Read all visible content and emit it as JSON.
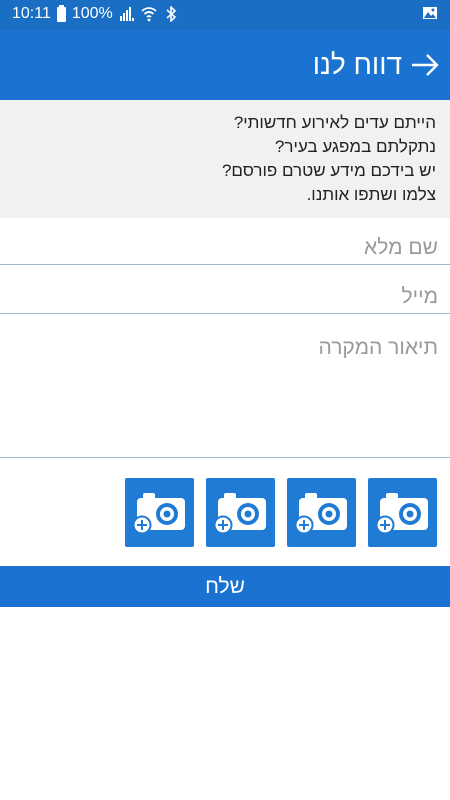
{
  "status_bar": {
    "time": "10:11",
    "battery": "100%"
  },
  "app_bar": {
    "title": "דווח לנו"
  },
  "intro": {
    "lines": [
      "הייתם עדים לאירוע חדשותי?",
      "נתקלתם במפגע בעיר?",
      "יש בידכם מידע שטרם פורסם?",
      "צלמו ושתפו אותנו."
    ]
  },
  "form": {
    "full_name_placeholder": "שם מלא",
    "email_placeholder": "מייל",
    "description_placeholder": "תיאור המקרה"
  },
  "photo_buttons": [
    "add-photo-icon",
    "add-photo-icon",
    "add-photo-icon",
    "add-photo-icon"
  ],
  "send_label": "שלח",
  "colors": {
    "primary": "#1a73d1",
    "status": "#1a6fc4",
    "intro_bg": "#f1f1f1"
  }
}
